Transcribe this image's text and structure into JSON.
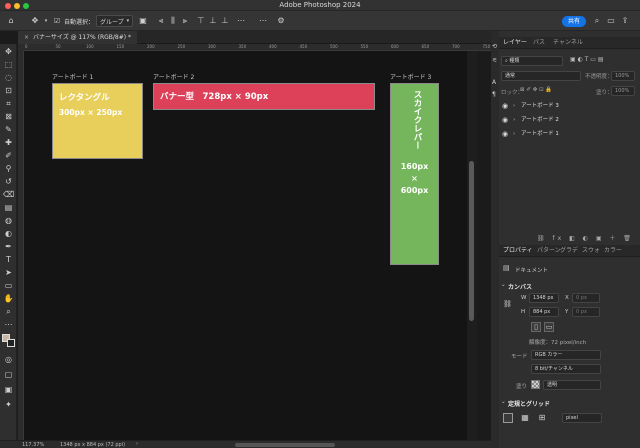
{
  "app_title": "Adobe Photoshop 2024",
  "options": {
    "auto_select_label": "自動選択：",
    "auto_select_value": "グループ",
    "share_label": "共有"
  },
  "document": {
    "tab_title": "バナーサイズ @ 117% (RGB/8#) *"
  },
  "ruler_ticks": [
    "0",
    "50",
    "100",
    "150",
    "200",
    "250",
    "300",
    "350",
    "400",
    "450",
    "500",
    "550",
    "600",
    "650",
    "700",
    "750",
    "800",
    "850",
    "900",
    "950",
    "1000",
    "1050",
    "1100",
    "1150",
    "1200",
    "1250",
    "1300",
    "1350",
    "1400",
    "1450"
  ],
  "artboards": [
    {
      "label": "アートボード 1",
      "line1": "レクタングル",
      "line2": "300px × 250px",
      "color": "#e8cf5c"
    },
    {
      "label": "アートボード 2",
      "line1": "バナー型　728px × 90px",
      "color": "#dc4159"
    },
    {
      "label": "アートボード 3",
      "line1": "スカイクレパー",
      "line2": "160px",
      "line3": "×",
      "line4": "600px",
      "color": "#75b65c"
    }
  ],
  "status": {
    "zoom": "117.37%",
    "doc_size": "1348 px x 884 px (72 ppi)"
  },
  "layers_panel": {
    "tabs": [
      "レイヤー",
      "パス",
      "チャンネル"
    ],
    "filter_label": "種類",
    "blend_mode": "通常",
    "opacity_label": "不透明度：",
    "opacity_value": "100%",
    "lock_label": "ロック：",
    "fill_label": "塗り：",
    "fill_value": "100%",
    "layers": [
      "アートボード 3",
      "アートボード 2",
      "アートボード 1"
    ]
  },
  "properties_panel": {
    "tabs": [
      "プロパティ",
      "パターン",
      "グラデ",
      "スウォ",
      "カラー"
    ],
    "doc_label": "ドキュメント",
    "canvas_title": "カンバス",
    "w_label": "W",
    "w_value": "1348 px",
    "x_label": "X",
    "x_placeholder": "0 px",
    "h_label": "H",
    "h_value": "884 px",
    "y_label": "Y",
    "y_placeholder": "0 px",
    "resolution": "解像度：72 pixel/inch",
    "mode_label": "モード",
    "mode_value": "RGB カラー",
    "bit_value": "8 bit/チャンネル",
    "fill_label": "塗り",
    "fill_value": "透明",
    "rulers_title": "定規とグリッド",
    "unit_value": "pixel"
  }
}
